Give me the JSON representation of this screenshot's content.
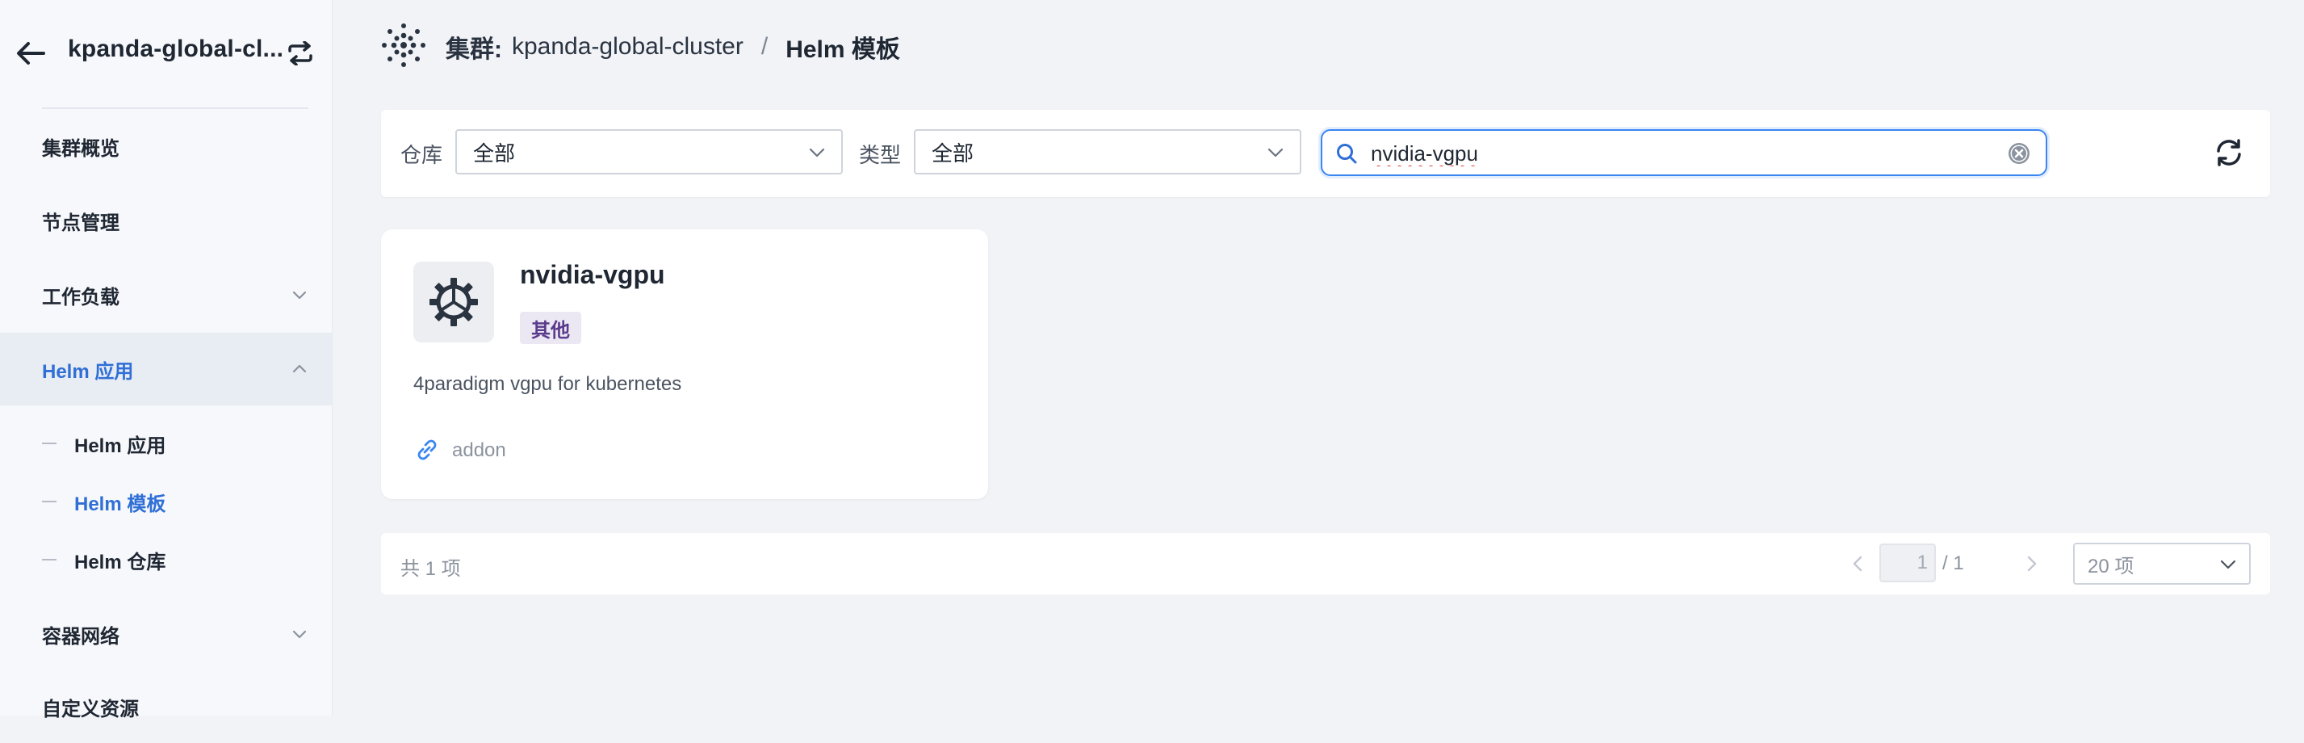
{
  "sidebar": {
    "cluster_title": "kpanda-global-cl...",
    "items": [
      {
        "label": "集群概览"
      },
      {
        "label": "节点管理"
      },
      {
        "label": "工作负载"
      },
      {
        "label": "Helm 应用"
      },
      {
        "label": "容器网络"
      },
      {
        "label": "自定义资源"
      }
    ],
    "sub_items": [
      {
        "label": "Helm 应用"
      },
      {
        "label": "Helm 模板"
      },
      {
        "label": "Helm 仓库"
      }
    ]
  },
  "breadcrumb": {
    "cluster_label": "集群:",
    "cluster_name": "kpanda-global-cluster",
    "separator": "/",
    "current": "Helm 模板"
  },
  "filters": {
    "repo_label": "仓库",
    "repo_value": "全部",
    "type_label": "类型",
    "type_value": "全部",
    "search_value": "nvidia-vgpu"
  },
  "cards": [
    {
      "title": "nvidia-vgpu",
      "tag": "其他",
      "description": "4paradigm vgpu for kubernetes",
      "repo": "addon"
    }
  ],
  "pagination": {
    "total": "共 1 项",
    "current_page": "1",
    "page_total": "/ 1",
    "page_size": "20 项"
  },
  "colors": {
    "accent": "#2f6fd6",
    "search_border": "#3a86f0",
    "tag_bg": "#ece8f3",
    "tag_text": "#5b3b8c"
  }
}
